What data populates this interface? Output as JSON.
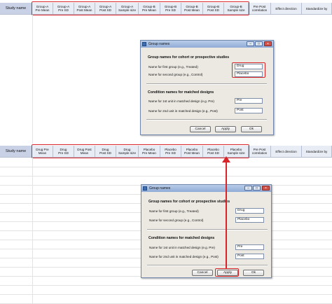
{
  "top_grid": {
    "study_name": "Study name",
    "columns": [
      "Group-A\nPre Mean",
      "Group-A\nPre SD",
      "Group-A\nPost Mean",
      "Group-A\nPost SD",
      "Group-A\nSample size",
      "Group-B\nPre Mean",
      "Group-B\nPre SD",
      "Group-B\nPost Mean",
      "Group-B\nPost SD",
      "Group-B\nSample size"
    ],
    "extra_columns": [
      "Pre Post\ncorrelation",
      "Effect direction",
      "Standardize by"
    ]
  },
  "bottom_grid": {
    "study_name": "Study name",
    "columns": [
      "Drug Pre\nMean",
      "Drug\nPre SD",
      "Drug Post\nMean",
      "Drug\nPost SD",
      "Drug\nSample size",
      "Placebo\nPre Mean",
      "Placebo\nPre SD",
      "Placebo\nPost Mean",
      "Placebo\nPost SD",
      "Placebo\nSample size"
    ],
    "extra_columns": [
      "Pre Post\ncorrelation",
      "Effect direction",
      "Standardize by"
    ]
  },
  "dialog_top": {
    "title": "Group names",
    "section1": "Group names for cohort or prospective studies",
    "first_group_label": "Name for first group (e.g., Treated)",
    "first_group_value": "Drug",
    "second_group_label": "Name for second group (e.g., Control)",
    "second_group_value": "Placebo",
    "section2": "Condition names for matched designs",
    "unit1_label": "Name for 1st unit in matched design (e.g. Pre)",
    "unit1_value": "Pre",
    "unit2_label": "Name for 2nd unit in matched design (e.g., Post)",
    "unit2_value": "Post",
    "cancel": "Cancel",
    "apply": "Apply",
    "ok": "Ok"
  },
  "dialog_bottom": {
    "title": "Group names",
    "section1": "Group names for cohort or prospective studies",
    "first_group_label": "Name for first group (e.g., Treated)",
    "first_group_value": "Drug",
    "second_group_label": "Name for second group (e.g., Control)",
    "second_group_value": "Placebo",
    "section2": "Condition names for matched designs",
    "unit1_label": "Name for 1st unit in matched design (e.g. Pre)",
    "unit1_value": "Pre",
    "unit2_label": "Name for 2nd unit in matched design (e.g., Post)",
    "unit2_value": "Post",
    "cancel": "Cancel",
    "apply": "Apply",
    "ok": "Ok"
  },
  "colors": {
    "highlight": "#d9242a",
    "header_bg": "#e8ecf5",
    "dialog_bg": "#ece9e2"
  }
}
